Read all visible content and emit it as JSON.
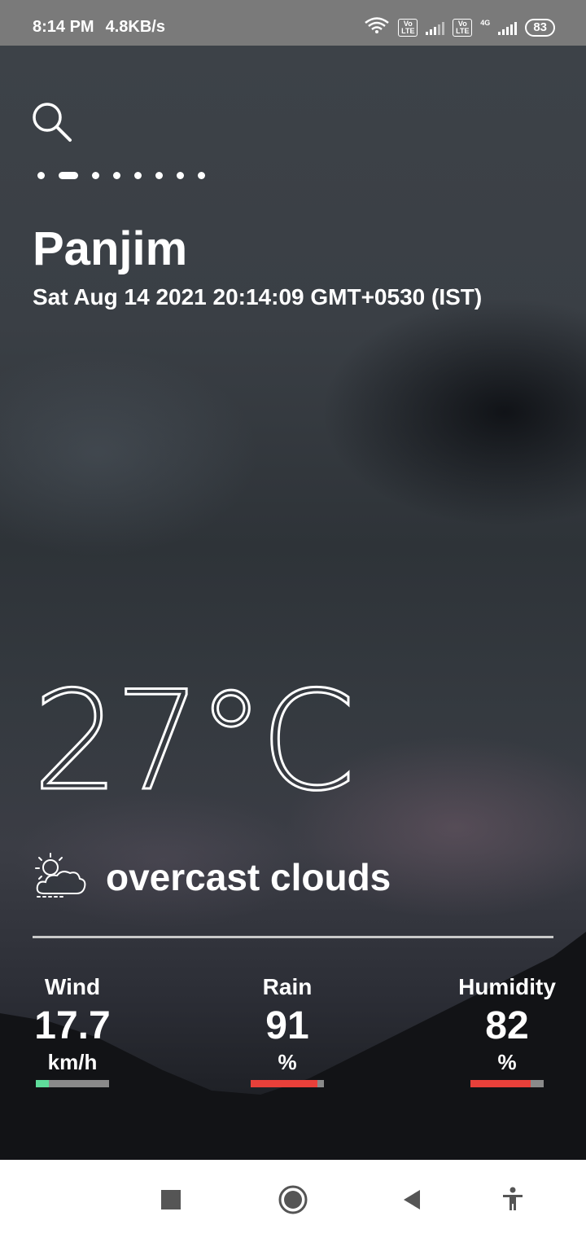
{
  "status_bar": {
    "time": "8:14 PM",
    "speed": "4.8KB/s",
    "volte1": "Vo LTE",
    "volte2": "Vo LTE",
    "network": "4G",
    "battery": "83"
  },
  "location": {
    "city": "Panjim",
    "datetime": "Sat Aug 14 2021 20:14:09 GMT+0530 (IST)"
  },
  "pager": {
    "count": 8,
    "active_index": 1
  },
  "weather": {
    "temperature": "27°C",
    "condition": "overcast clouds",
    "icon": "partly-cloudy-icon"
  },
  "stats": {
    "wind": {
      "label": "Wind",
      "value": "17.7",
      "unit": "km/h",
      "level": 0.18,
      "color": "#5fdc9b"
    },
    "rain": {
      "label": "Rain",
      "value": "91",
      "unit": "%",
      "level": 0.91,
      "color": "#e8403a"
    },
    "humidity": {
      "label": "Humidity",
      "value": "82",
      "unit": "%",
      "level": 0.82,
      "color": "#e8403a"
    }
  },
  "colors": {
    "status_bar": "#7a7a7a",
    "bar_track": "#8a8a8a"
  }
}
